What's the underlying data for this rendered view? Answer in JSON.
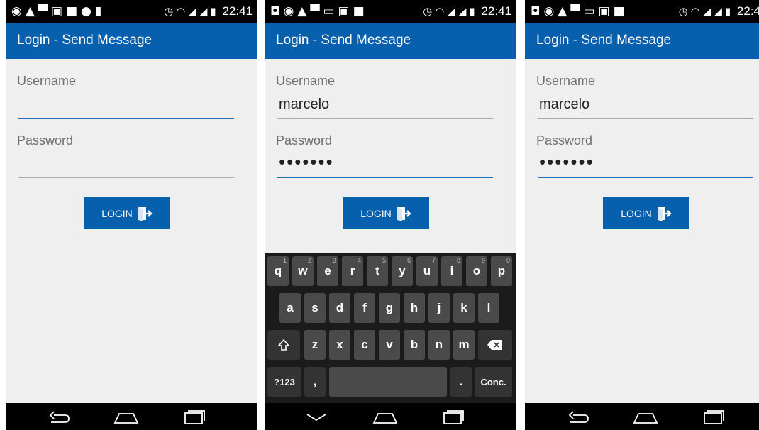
{
  "status_bar": {
    "time": "22:41",
    "time_cut": "22:4"
  },
  "app": {
    "title": "Login - Send Message"
  },
  "form": {
    "username_label": "Username",
    "password_label": "Password",
    "username_value": "marcelo",
    "password_masked": "•••••••",
    "login_label": "LOGIN"
  },
  "keyboard": {
    "row1": [
      "q",
      "w",
      "e",
      "r",
      "t",
      "y",
      "u",
      "i",
      "o",
      "p"
    ],
    "row1_hints": [
      "1",
      "2",
      "3",
      "4",
      "5",
      "6",
      "7",
      "8",
      "9",
      "0"
    ],
    "row2": [
      "a",
      "s",
      "d",
      "f",
      "g",
      "h",
      "j",
      "k",
      "l"
    ],
    "row3": [
      "z",
      "x",
      "c",
      "v",
      "b",
      "n",
      "m"
    ],
    "symbols_key": "?123",
    "comma_key": ",",
    "period_key": ".",
    "enter_key": "Conc."
  },
  "icons": {
    "status_left": [
      "whatsapp-icon",
      "app-icon",
      "gallery-icon",
      "mail-icon",
      "chat-icon",
      "check-icon",
      "bars-icon"
    ],
    "status_right": [
      "alarm-icon",
      "wifi-icon",
      "signal1-icon",
      "signal2-icon",
      "battery-icon"
    ],
    "login": "exit-door-icon",
    "nav": [
      "back-icon",
      "home-icon",
      "recents-icon"
    ]
  }
}
